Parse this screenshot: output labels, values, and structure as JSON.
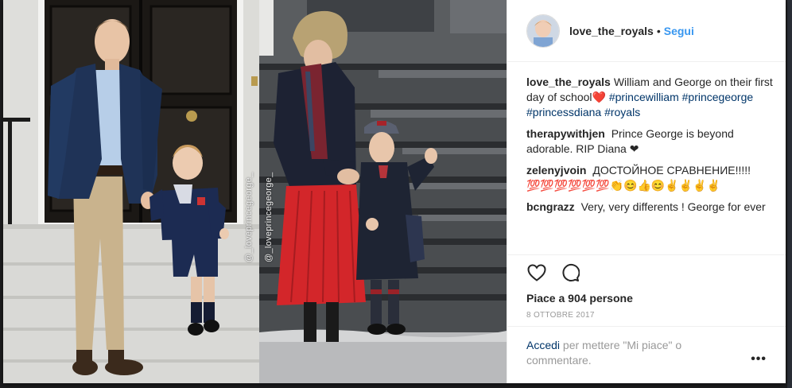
{
  "post": {
    "watermark_left": "@_loveprincegeorge_",
    "watermark_right": "@_loveprincegeorge_"
  },
  "header": {
    "username": "love_the_royals",
    "separator": "•",
    "follow_label": "Segui"
  },
  "comments": [
    {
      "author": "love_the_royals",
      "text": "William and George on their first day of school❤️ ",
      "hashtags": [
        "#princewilliam",
        "#princegeorge",
        "#princessdiana",
        "#royals"
      ]
    },
    {
      "author": "therapywithjen",
      "text": "Prince George is beyond adorable. RIP Diana ❤"
    },
    {
      "author": "zelenyjvoin",
      "text": "ДОСТОЙНОЕ СРАВНЕНИЕ!!!!! 💯💯💯💯💯💯👏😊👍😊✌✌✌✌"
    },
    {
      "author": "bcngrazz",
      "text": "Very, very differents ! George for ever"
    }
  ],
  "actions": {
    "like_icon": "heart-outline-icon",
    "comment_icon": "speech-bubble-icon",
    "likes_text": "Piace a 904 persone",
    "date": "8 OTTOBRE 2017"
  },
  "login": {
    "link_text": "Accedi",
    "rest_text": " per mettere \"Mi piace\" o commentare.",
    "more_label": "•••"
  },
  "colors": {
    "link_blue": "#3897f0",
    "hashtag_blue": "#003569",
    "text_dark": "#262626",
    "text_muted": "#999999",
    "divider": "#efefef"
  }
}
